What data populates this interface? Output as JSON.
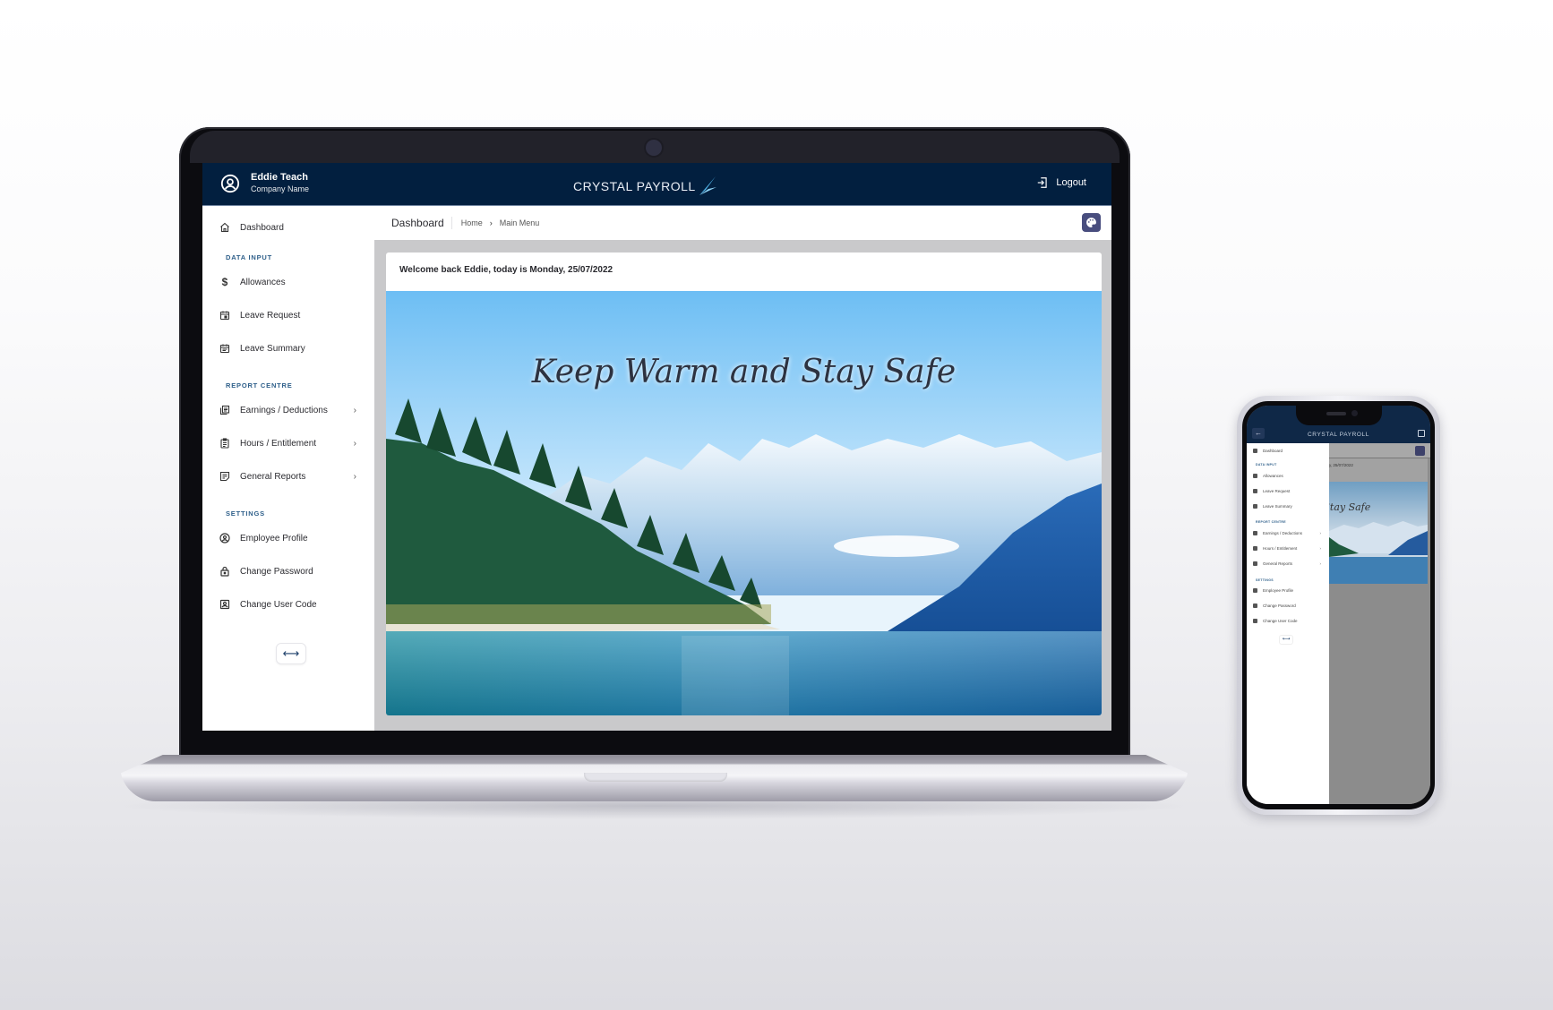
{
  "header": {
    "user_name": "Eddie Teach",
    "company_name": "Company Name",
    "brand": "CRYSTAL PAYROLL",
    "logout_label": "Logout"
  },
  "sidebar": {
    "dashboard": "Dashboard",
    "sections": [
      {
        "title": "DATA INPUT",
        "items": [
          {
            "label": "Allowances",
            "icon": "dollar-icon"
          },
          {
            "label": "Leave Request",
            "icon": "calendar-event-icon"
          },
          {
            "label": "Leave Summary",
            "icon": "calendar-list-icon"
          }
        ]
      },
      {
        "title": "REPORT CENTRE",
        "items": [
          {
            "label": "Earnings / Deductions",
            "icon": "documents-icon",
            "has_submenu": true
          },
          {
            "label": "Hours / Entitlement",
            "icon": "clipboard-icon",
            "has_submenu": true
          },
          {
            "label": "General Reports",
            "icon": "report-icon",
            "has_submenu": true
          }
        ]
      },
      {
        "title": "SETTINGS",
        "items": [
          {
            "label": "Employee Profile",
            "icon": "user-circle-icon"
          },
          {
            "label": "Change Password",
            "icon": "lock-icon"
          },
          {
            "label": "Change User Code",
            "icon": "id-badge-icon"
          }
        ]
      }
    ],
    "collapse_glyph": "⟷",
    "chevron": "›"
  },
  "breadcrumb": {
    "title": "Dashboard",
    "items": [
      "Home",
      "Main Menu"
    ],
    "separator": "›"
  },
  "main": {
    "welcome": "Welcome back Eddie, today is Monday, 25/07/2022",
    "hero_text": "Keep Warm and Stay Safe"
  },
  "phone": {
    "brand": "CRYSTAL PAYROLL",
    "back_glyph": "←",
    "welcome_partial": "y, 25/07/2022",
    "hero_partial": "rm and Stay Safe"
  },
  "colors": {
    "header_bg": "#021f3f",
    "section_title": "#2e5f8a",
    "theme_button": "#484d7e",
    "logo_accent": "#4fb3e8"
  }
}
